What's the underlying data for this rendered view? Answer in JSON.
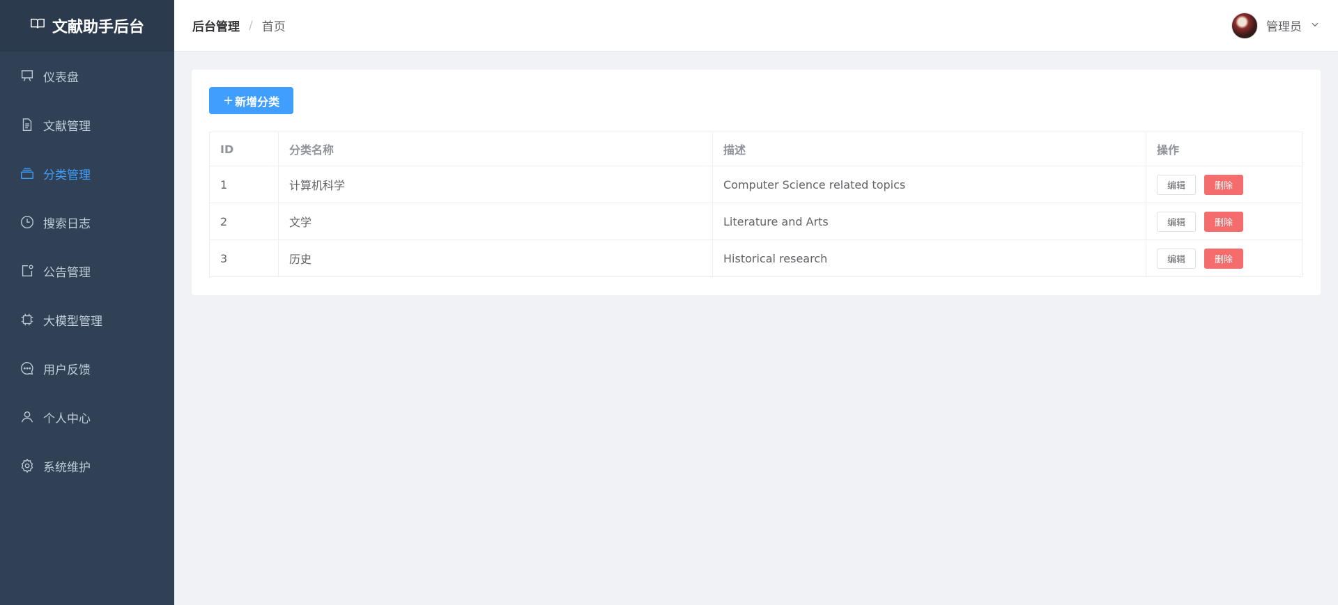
{
  "sidebar": {
    "title": "文献助手后台",
    "logo_icon": "book-open-icon",
    "items": [
      {
        "label": "仪表盘",
        "icon": "presentation-board-icon",
        "active": false
      },
      {
        "label": "文献管理",
        "icon": "document-icon",
        "active": false
      },
      {
        "label": "分类管理",
        "icon": "layers-icon",
        "active": true
      },
      {
        "label": "搜索日志",
        "icon": "clock-icon",
        "active": false
      },
      {
        "label": "公告管理",
        "icon": "notification-icon",
        "active": false
      },
      {
        "label": "大模型管理",
        "icon": "cpu-icon",
        "active": false
      },
      {
        "label": "用户反馈",
        "icon": "chat-dots-icon",
        "active": false
      },
      {
        "label": "个人中心",
        "icon": "user-icon",
        "active": false
      },
      {
        "label": "系统维护",
        "icon": "gear-icon",
        "active": false
      }
    ]
  },
  "header": {
    "breadcrumb": [
      "后台管理",
      "首页"
    ],
    "separator": "/",
    "user_name": "管理员"
  },
  "main": {
    "add_button": "新增分类",
    "add_button_prefix": "+",
    "table": {
      "columns": [
        "ID",
        "分类名称",
        "描述",
        "操作"
      ],
      "rows": [
        {
          "id": "1",
          "name": "计算机科学",
          "desc": "Computer Science related topics"
        },
        {
          "id": "2",
          "name": "文学",
          "desc": "Literature and Arts"
        },
        {
          "id": "3",
          "name": "历史",
          "desc": "Historical research"
        }
      ],
      "edit_label": "编辑",
      "delete_label": "删除"
    }
  },
  "colors": {
    "sidebar_bg": "#304156",
    "accent": "#409eff",
    "danger": "#f56c6c"
  }
}
